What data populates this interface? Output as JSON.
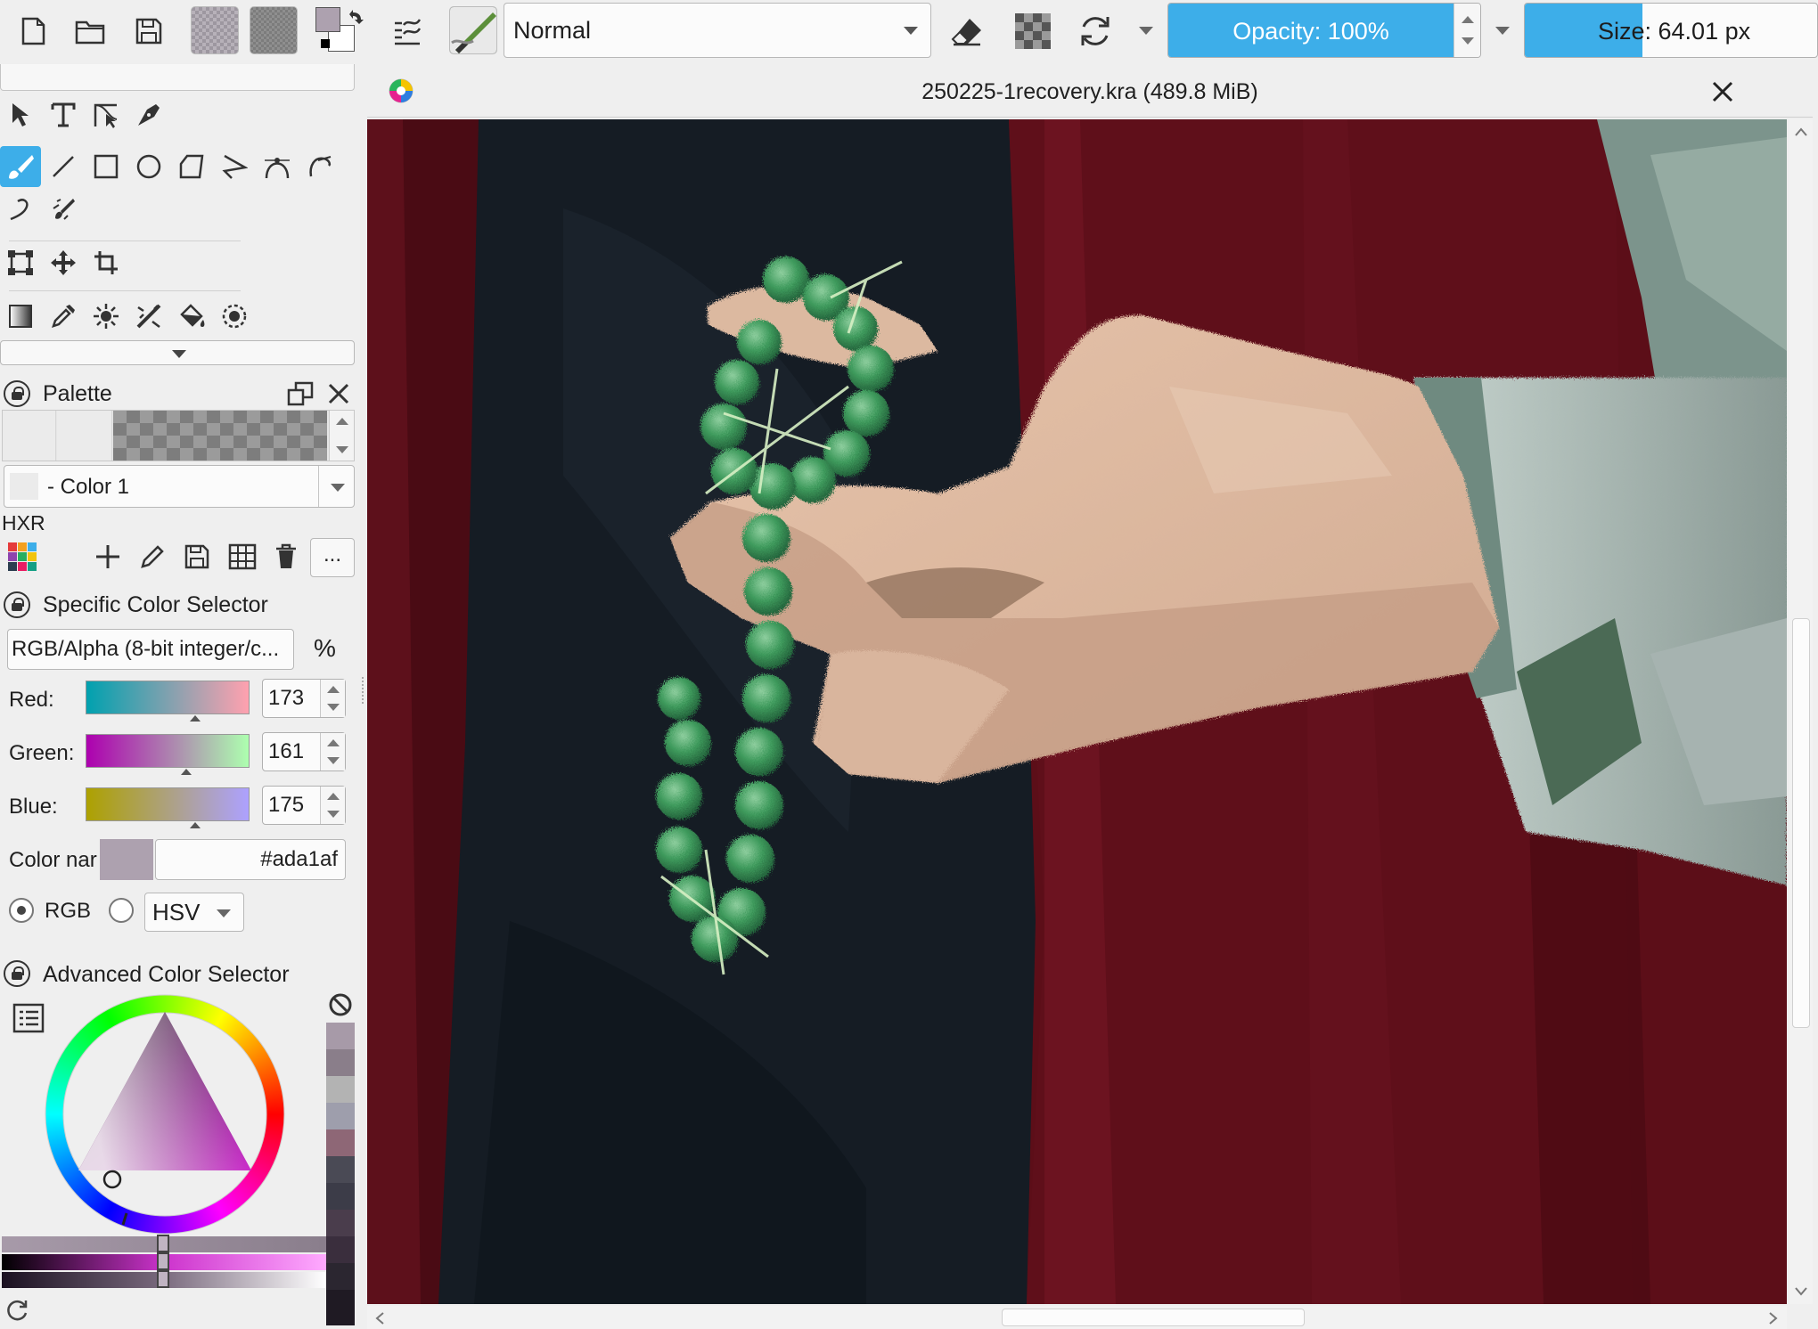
{
  "toolbar": {
    "blend_mode": "Normal",
    "opacity_label": "Opacity: 100%",
    "opacity_value": 1.0,
    "size_label": "Size: 64.01 px",
    "size_value": 0.2,
    "foreground_color": "#ada1af",
    "background_color": "#000000"
  },
  "document": {
    "title": "250225-1recovery.kra (489.8 MiB)"
  },
  "palette": {
    "title": "Palette",
    "selected_color_label": "- Color 1",
    "palette_name": "HXR",
    "more_label": "..."
  },
  "specific_color": {
    "title": "Specific Color Selector",
    "color_model": "RGB/Alpha (8-bit integer/c...",
    "percent_label": "%",
    "red_label": "Red:",
    "red_value": "173",
    "green_label": "Green:",
    "green_value": "161",
    "blue_label": "Blue:",
    "blue_value": "175",
    "color_name_label": "Color nar",
    "hex_value": "#ada1af",
    "rgb_label": "RGB",
    "hsv_label": "HSV"
  },
  "advanced_color": {
    "title": "Advanced Color Selector"
  },
  "colors": {
    "accent": "#3daee9",
    "current": "#ada1af"
  }
}
